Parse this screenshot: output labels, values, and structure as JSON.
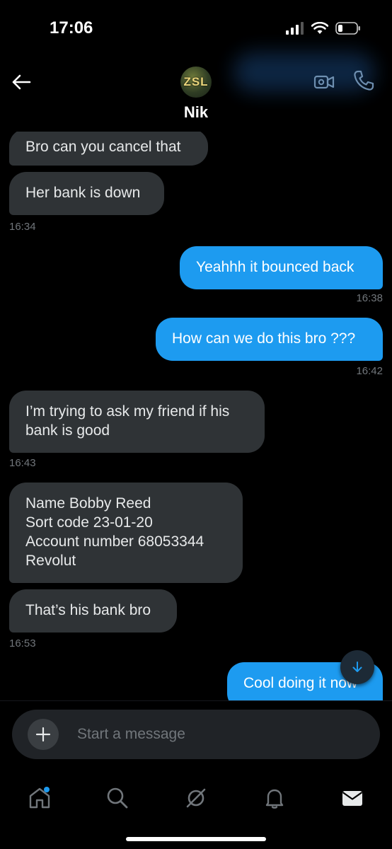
{
  "status_bar": {
    "time": "17:06"
  },
  "header": {
    "contact_name": "Nik",
    "avatar_text": "ZSL"
  },
  "messages": [
    {
      "direction": "received",
      "text": "Bro can you cancel that"
    },
    {
      "direction": "received",
      "text": "Her bank is down",
      "time": "16:34"
    },
    {
      "direction": "sent",
      "text": "Yeahhh it bounced back",
      "time": "16:38"
    },
    {
      "direction": "sent",
      "text": "How can we do this bro ???",
      "time": "16:42"
    },
    {
      "direction": "received",
      "lines": [
        "I’m trying to ask my friend if his",
        "bank is good"
      ],
      "time": "16:43"
    },
    {
      "direction": "received",
      "lines": [
        "Name Bobby Reed",
        "Sort code 23-01-20",
        "Account number 68053344",
        "Revolut"
      ]
    },
    {
      "direction": "received",
      "text": "That’s his bank bro",
      "time": "16:53"
    },
    {
      "direction": "sent",
      "text": "Cool doing it now"
    }
  ],
  "composer": {
    "placeholder": "Start a message"
  },
  "tabs": [
    {
      "name": "home",
      "icon": "home-icon",
      "has_notification_dot": true
    },
    {
      "name": "search",
      "icon": "search-icon"
    },
    {
      "name": "grok",
      "icon": "grok-icon"
    },
    {
      "name": "notifications",
      "icon": "bell-icon"
    },
    {
      "name": "messages",
      "icon": "envelope-icon",
      "active": true
    }
  ],
  "colors": {
    "sent_bubble": "#1d9bf0",
    "received_bubble": "#2f3336",
    "timestamp": "#71767b",
    "voice_accent": "#8b5cf6"
  }
}
